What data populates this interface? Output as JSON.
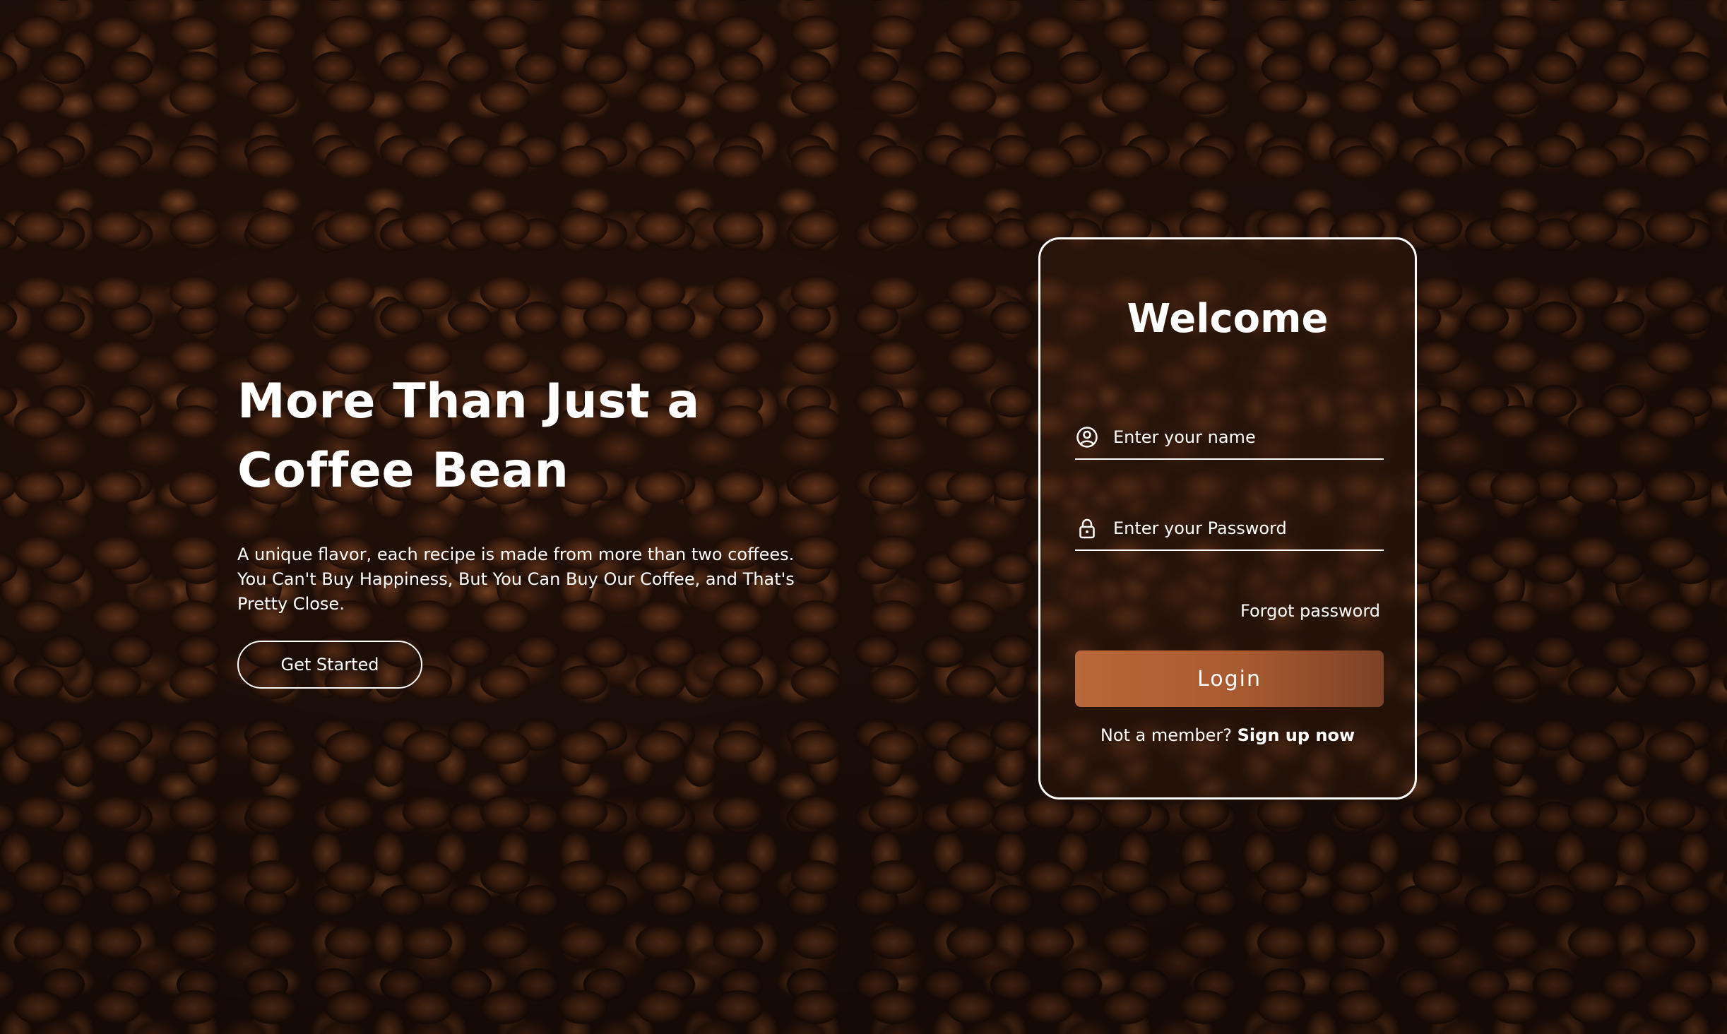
{
  "hero": {
    "title_line1": "More Than Just a",
    "title_line2": "Coffee Bean",
    "description": "A unique flavor, each recipe is made from more than two coffees. You Can't Buy Happiness, But You Can Buy Our Coffee, and That's Pretty Close.",
    "cta_label": "Get Started"
  },
  "login": {
    "title": "Welcome",
    "name_placeholder": "Enter your name",
    "password_placeholder": "Enter your Password",
    "name_icon": "user-circle-icon",
    "password_icon": "lock-icon",
    "forgot_label": "Forgot password",
    "submit_label": "Login",
    "signup_prompt": "Not a member?",
    "signup_link": "Sign up now"
  },
  "colors": {
    "accent": "#b8683a",
    "text": "#ffffff",
    "background": "#2b150b"
  }
}
